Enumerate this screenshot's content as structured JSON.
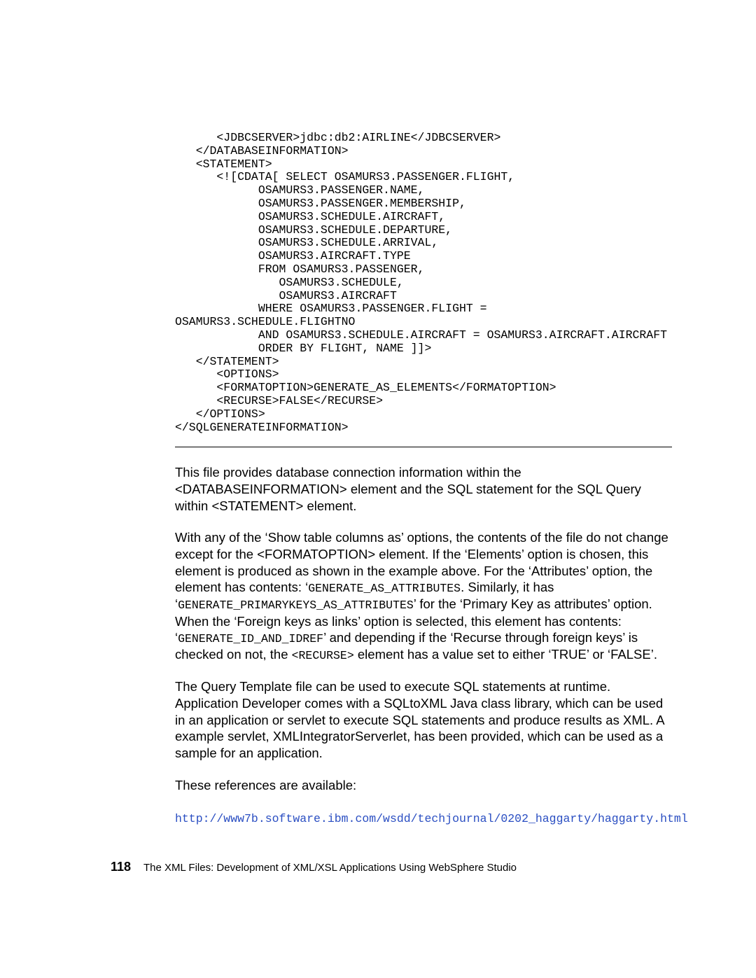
{
  "code": "      <JDBCSERVER>jdbc:db2:AIRLINE</JDBCSERVER>\n   </DATABASEINFORMATION>\n   <STATEMENT>\n      <![CDATA[ SELECT OSAMURS3.PASSENGER.FLIGHT,\n            OSAMURS3.PASSENGER.NAME,\n            OSAMURS3.PASSENGER.MEMBERSHIP,\n            OSAMURS3.SCHEDULE.AIRCRAFT,\n            OSAMURS3.SCHEDULE.DEPARTURE,\n            OSAMURS3.SCHEDULE.ARRIVAL,\n            OSAMURS3.AIRCRAFT.TYPE\n            FROM OSAMURS3.PASSENGER,\n               OSAMURS3.SCHEDULE,\n               OSAMURS3.AIRCRAFT\n            WHERE OSAMURS3.PASSENGER.FLIGHT =\nOSAMURS3.SCHEDULE.FLIGHTNO\n            AND OSAMURS3.SCHEDULE.AIRCRAFT = OSAMURS3.AIRCRAFT.AIRCRAFT\n            ORDER BY FLIGHT, NAME ]]>\n   </STATEMENT>\n      <OPTIONS>\n      <FORMATOPTION>GENERATE_AS_ELEMENTS</FORMATOPTION>\n      <RECURSE>FALSE</RECURSE>\n   </OPTIONS>\n</SQLGENERATEINFORMATION>",
  "para1": "This file provides database connection information within the <DATABASEINFORMATION> element and the SQL statement for the SQL Query within <STATEMENT> element.",
  "para2": {
    "t1": "With any of the ‘Show table columns as’ options, the contents of the file do not change except for the <FORMATOPTION> element. If the ‘Elements’ option is chosen, this element is produced as shown in the example above. For the ‘Attributes’ option, the element has contents: ‘",
    "m1": "GENERATE_AS_ATTRIBUTES",
    "t2": ". Similarly, it has ‘",
    "m2": "GENERATE_PRIMARYKEYS_AS_ATTRIBUTES",
    "t3": "’ for the ‘Primary Key as attributes’ option. When the ‘Foreign keys as links’ option is selected, this element has contents: ‘",
    "m3": "GENERATE_ID_AND_IDREF",
    "t4": "’ and depending if the ‘Recurse through foreign keys’ is checked on not, the ",
    "m4": "<RECURSE>",
    "t5": " element has a value set to either ‘TRUE’ or ‘FALSE’."
  },
  "para3": "The Query Template file can be used to execute SQL statements at runtime. Application Developer comes with a SQLtoXML Java class library, which can be used in an application or servlet to execute SQL statements and produce results as XML. A example servlet, XMLIntegratorServerlet, has been provided, which can be used as a sample for an application.",
  "para4": "These references are available:",
  "link": "http://www7b.software.ibm.com/wsdd/techjournal/0202_haggarty/haggarty.html",
  "footer": {
    "pageno": "118",
    "title": "The XML Files:  Development of XML/XSL Applications Using WebSphere Studio"
  }
}
